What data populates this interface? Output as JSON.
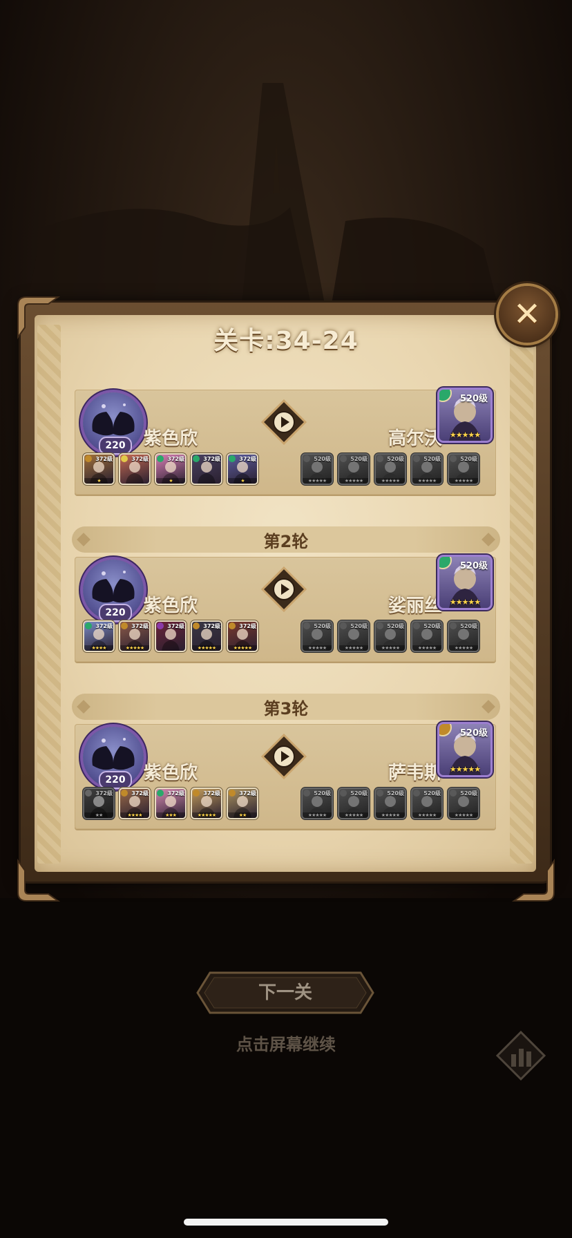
{
  "stage_title": "关卡:34-24",
  "close_icon": "close-icon",
  "rounds": [
    {
      "label": "",
      "player": {
        "name": "紫色欣",
        "level": "220"
      },
      "enemy": {
        "name": "高尔沃",
        "level": "520级",
        "stars": "★★★★★",
        "faction_color": "#2aa86a"
      },
      "player_heroes": [
        {
          "level": "372级",
          "stars": "★",
          "color": "#a0703a",
          "faction": "#c08a2a"
        },
        {
          "level": "372级",
          "stars": "",
          "color": "#c56a52",
          "faction": "#e2c94a"
        },
        {
          "level": "372级",
          "stars": "★",
          "color": "#d87fb4",
          "faction": "#2aa86a"
        },
        {
          "level": "372级",
          "stars": "",
          "color": "#4a4260",
          "faction": "#2aa86a"
        },
        {
          "level": "372级",
          "stars": "★",
          "color": "#5d5e9e",
          "faction": "#2aa86a"
        }
      ],
      "enemy_heroes": [
        {
          "level": "520级",
          "stars": "★★★★★"
        },
        {
          "level": "520级",
          "stars": "★★★★★"
        },
        {
          "level": "520级",
          "stars": "★★★★★"
        },
        {
          "level": "520级",
          "stars": "★★★★★"
        },
        {
          "level": "520级",
          "stars": "★★★★★"
        }
      ]
    },
    {
      "label": "第2轮",
      "player": {
        "name": "紫色欣",
        "level": "220"
      },
      "enemy": {
        "name": "娑丽丝",
        "level": "520级",
        "stars": "★★★★★",
        "faction_color": "#2aa86a"
      },
      "player_heroes": [
        {
          "level": "372级",
          "stars": "★★★★",
          "color": "#7a8ac4",
          "faction": "#2aa86a"
        },
        {
          "level": "372级",
          "stars": "★★★★★",
          "color": "#8c5a48",
          "faction": "#c08a2a"
        },
        {
          "level": "372级",
          "stars": "",
          "color": "#6a2438",
          "faction": "#8a3aa8"
        },
        {
          "level": "372级",
          "stars": "★★★★★",
          "color": "#3a3844",
          "faction": "#c08a2a"
        },
        {
          "level": "372级",
          "stars": "★★★★★",
          "color": "#7a3a2e",
          "faction": "#c08a2a"
        }
      ],
      "enemy_heroes": [
        {
          "level": "520级",
          "stars": "★★★★★"
        },
        {
          "level": "520级",
          "stars": "★★★★★"
        },
        {
          "level": "520级",
          "stars": "★★★★★"
        },
        {
          "level": "520级",
          "stars": "★★★★★"
        },
        {
          "level": "520级",
          "stars": "★★★★★"
        }
      ]
    },
    {
      "label": "第3轮",
      "player": {
        "name": "紫色欣",
        "level": "220"
      },
      "enemy": {
        "name": "萨韦斯",
        "level": "520级",
        "stars": "★★★★★",
        "faction_color": "#c08a2a"
      },
      "player_heroes": [
        {
          "level": "372级",
          "stars": "★★",
          "color": "#5a5050",
          "faction": "#888888",
          "grey": true
        },
        {
          "level": "372级",
          "stars": "★★★★",
          "color": "#9a6a48",
          "faction": "#c08a2a"
        },
        {
          "level": "372级",
          "stars": "★★★",
          "color": "#d58ab0",
          "faction": "#2aa86a"
        },
        {
          "level": "372级",
          "stars": "★★★★★",
          "color": "#c09a5a",
          "faction": "#c08a2a"
        },
        {
          "level": "372级",
          "stars": "★★",
          "color": "#a8905e",
          "faction": "#c08a2a"
        }
      ],
      "enemy_heroes": [
        {
          "level": "520级",
          "stars": "★★★★★"
        },
        {
          "level": "520级",
          "stars": "★★★★★"
        },
        {
          "level": "520级",
          "stars": "★★★★★"
        },
        {
          "level": "520级",
          "stars": "★★★★★"
        },
        {
          "level": "520级",
          "stars": "★★★★★"
        }
      ]
    }
  ],
  "next_button_label": "下一关",
  "hint_text": "点击屏幕继续",
  "stats_icon": "bar-chart-icon",
  "colors": {
    "parchment": "#e9d6b0",
    "frame": "#6b4e31",
    "backdrop": "#110b07"
  }
}
